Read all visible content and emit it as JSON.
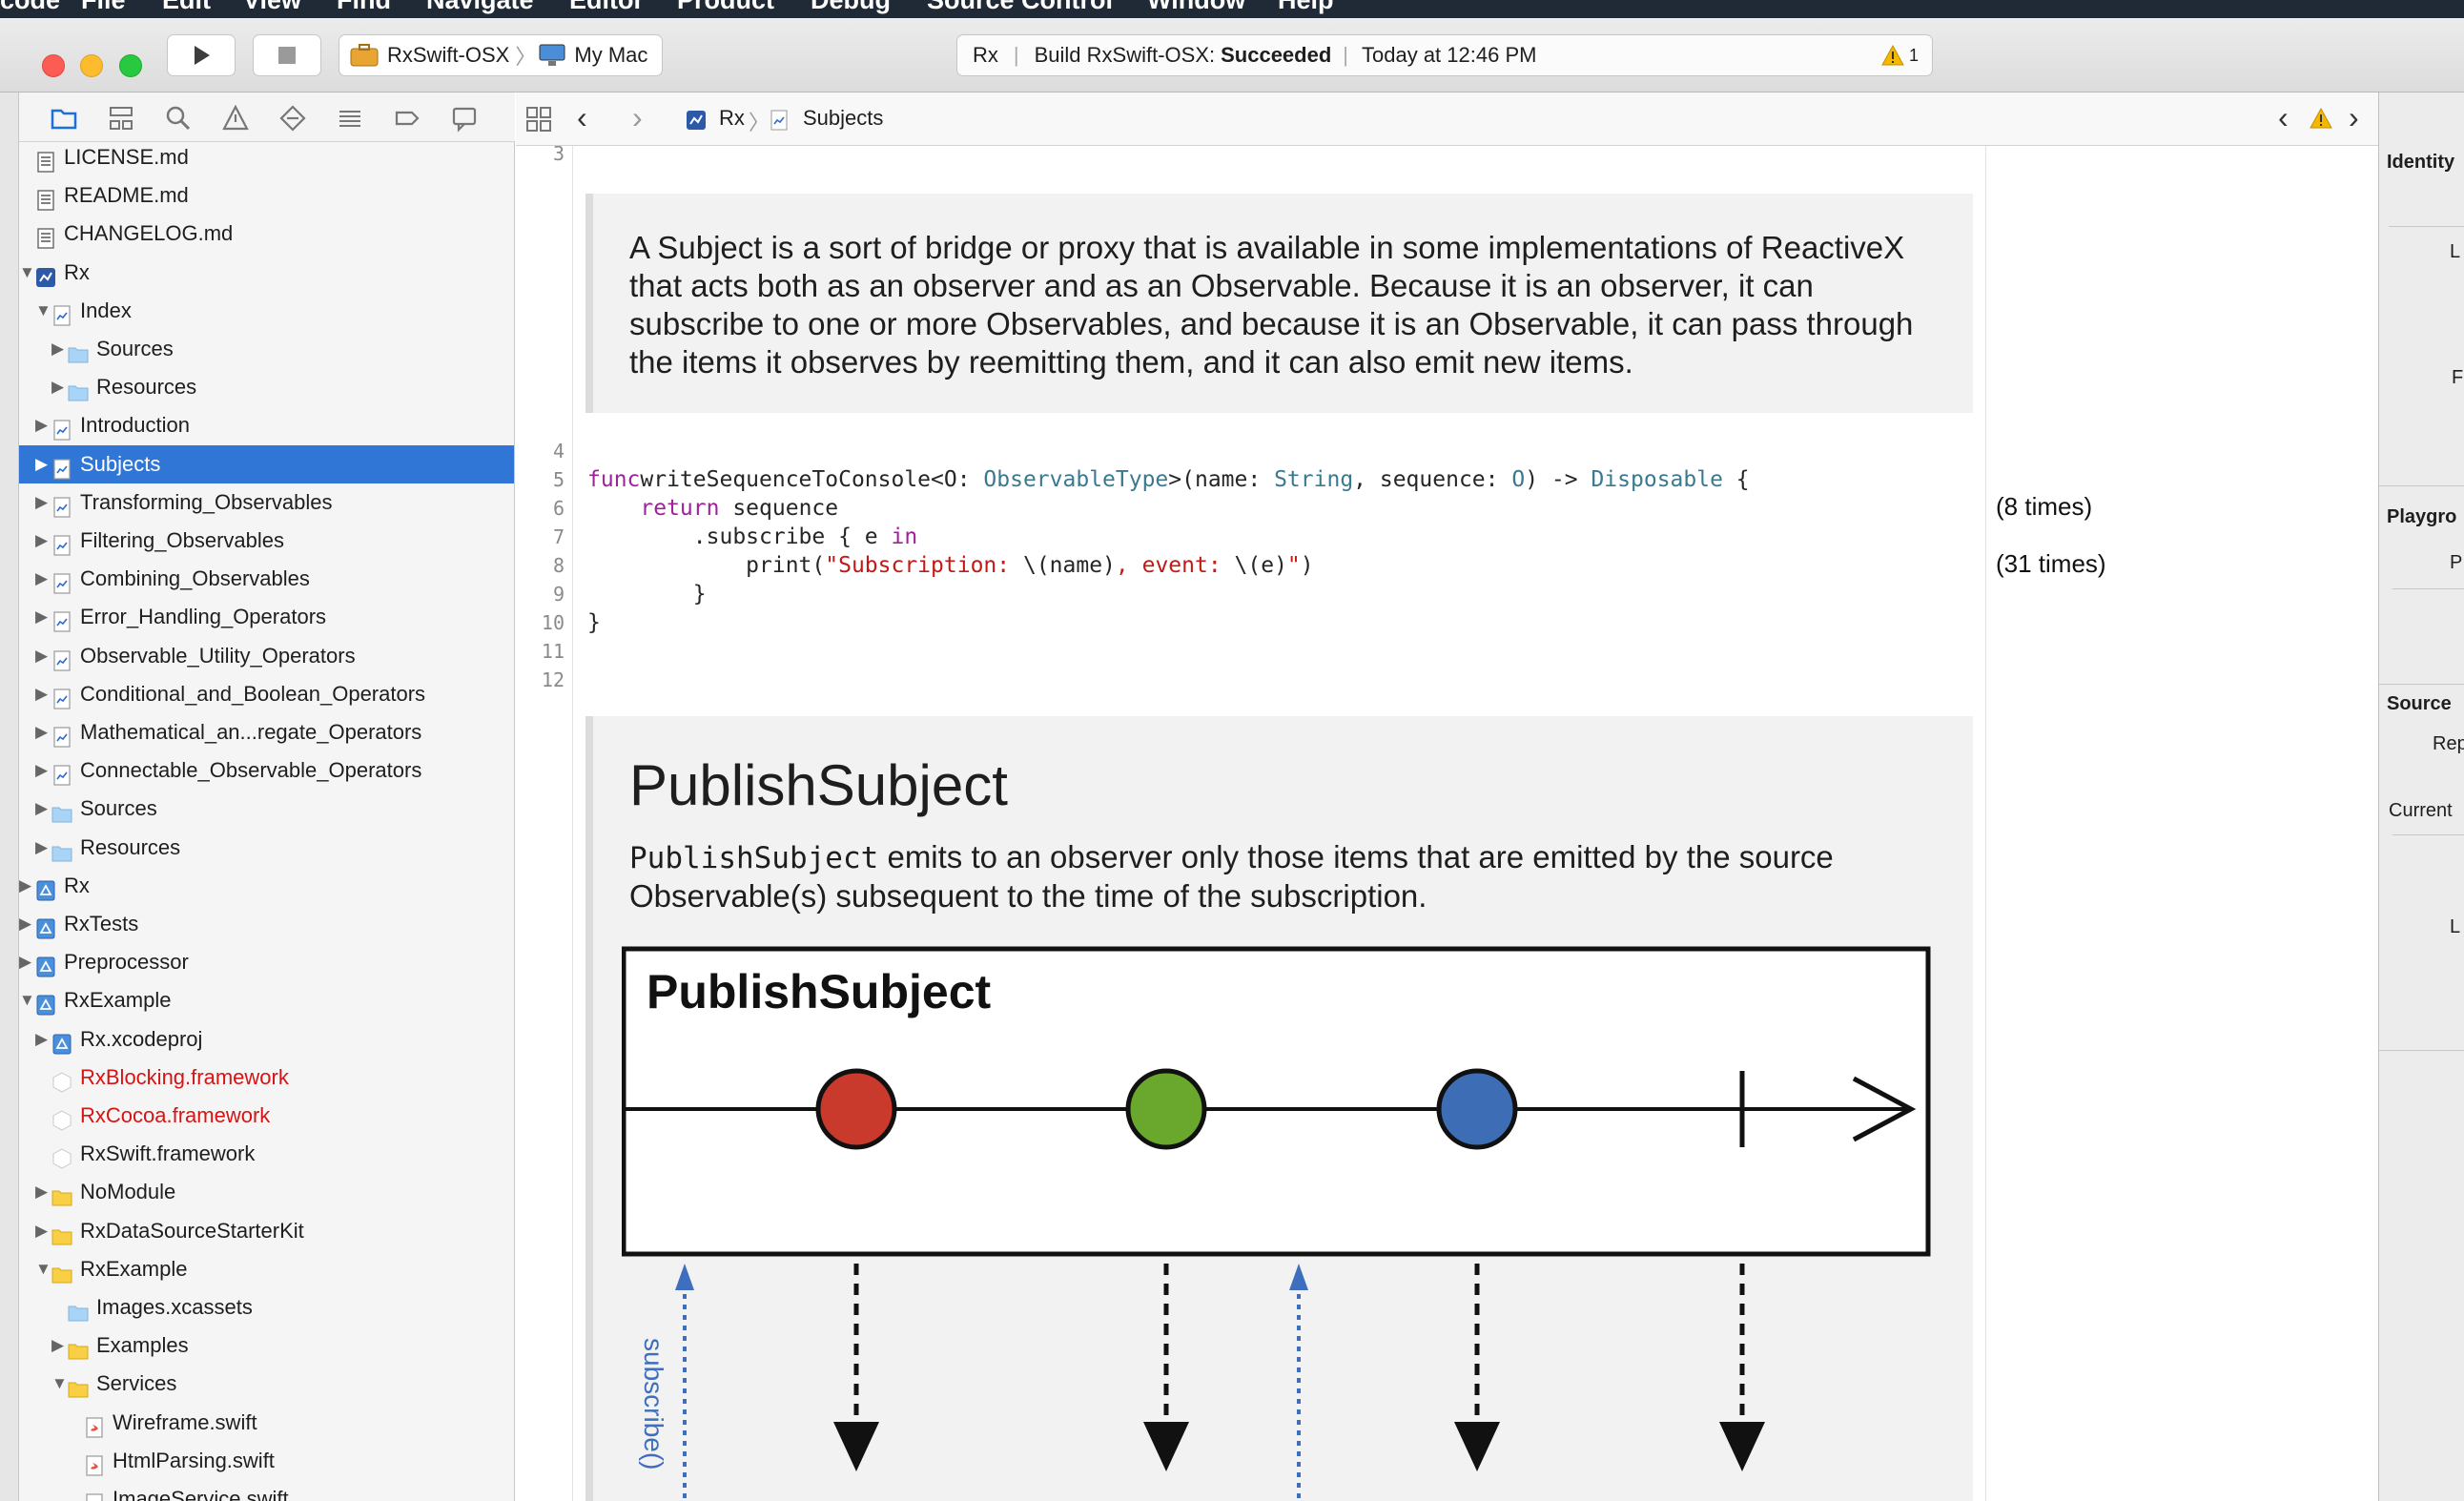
{
  "menu": [
    "Xcode",
    "File",
    "Edit",
    "View",
    "Find",
    "Navigate",
    "Editor",
    "Product",
    "Debug",
    "Source Control",
    "Window",
    "Help"
  ],
  "toolbar": {
    "scheme": "RxSwift-OSX",
    "destination": "My Mac",
    "activity_project": "Rx",
    "activity_status_prefix": "Build RxSwift-OSX:",
    "activity_status": "Succeeded",
    "activity_time": "Today at 12:46 PM",
    "warning_count": "1"
  },
  "navigator": {
    "rows": [
      {
        "label": "LICENSE.md",
        "indent": 0,
        "tri": "",
        "icon": "doc"
      },
      {
        "label": "README.md",
        "indent": 0,
        "tri": "",
        "icon": "doc"
      },
      {
        "label": "CHANGELOG.md",
        "indent": 0,
        "tri": "",
        "icon": "doc"
      },
      {
        "label": "Rx",
        "indent": 0,
        "tri": "open",
        "icon": "playground"
      },
      {
        "label": "Index",
        "indent": 1,
        "tri": "open",
        "icon": "page"
      },
      {
        "label": "Sources",
        "indent": 2,
        "tri": "closed",
        "icon": "folder-blue"
      },
      {
        "label": "Resources",
        "indent": 2,
        "tri": "closed",
        "icon": "folder-blue"
      },
      {
        "label": "Introduction",
        "indent": 1,
        "tri": "closed",
        "icon": "page"
      },
      {
        "label": "Subjects",
        "indent": 1,
        "tri": "closed",
        "icon": "page",
        "selected": true
      },
      {
        "label": "Transforming_Observables",
        "indent": 1,
        "tri": "closed",
        "icon": "page"
      },
      {
        "label": "Filtering_Observables",
        "indent": 1,
        "tri": "closed",
        "icon": "page"
      },
      {
        "label": "Combining_Observables",
        "indent": 1,
        "tri": "closed",
        "icon": "page"
      },
      {
        "label": "Error_Handling_Operators",
        "indent": 1,
        "tri": "closed",
        "icon": "page"
      },
      {
        "label": "Observable_Utility_Operators",
        "indent": 1,
        "tri": "closed",
        "icon": "page"
      },
      {
        "label": "Conditional_and_Boolean_Operators",
        "indent": 1,
        "tri": "closed",
        "icon": "page"
      },
      {
        "label": "Mathematical_an...regate_Operators",
        "indent": 1,
        "tri": "closed",
        "icon": "page"
      },
      {
        "label": "Connectable_Observable_Operators",
        "indent": 1,
        "tri": "closed",
        "icon": "page"
      },
      {
        "label": "Sources",
        "indent": 1,
        "tri": "closed",
        "icon": "folder-blue"
      },
      {
        "label": "Resources",
        "indent": 1,
        "tri": "closed",
        "icon": "folder-blue"
      },
      {
        "label": "Rx",
        "indent": 0,
        "tri": "closed",
        "icon": "project"
      },
      {
        "label": "RxTests",
        "indent": 0,
        "tri": "closed",
        "icon": "project"
      },
      {
        "label": "Preprocessor",
        "indent": 0,
        "tri": "closed",
        "icon": "project"
      },
      {
        "label": "RxExample",
        "indent": 0,
        "tri": "open",
        "icon": "project"
      },
      {
        "label": "Rx.xcodeproj",
        "indent": 1,
        "tri": "closed",
        "icon": "project"
      },
      {
        "label": "RxBlocking.framework",
        "indent": 1,
        "tri": "",
        "icon": "framework",
        "red": true
      },
      {
        "label": "RxCocoa.framework",
        "indent": 1,
        "tri": "",
        "icon": "framework",
        "red": true
      },
      {
        "label": "RxSwift.framework",
        "indent": 1,
        "tri": "",
        "icon": "framework"
      },
      {
        "label": "NoModule",
        "indent": 1,
        "tri": "closed",
        "icon": "folder"
      },
      {
        "label": "RxDataSourceStarterKit",
        "indent": 1,
        "tri": "closed",
        "icon": "folder"
      },
      {
        "label": "RxExample",
        "indent": 1,
        "tri": "open",
        "icon": "folder"
      },
      {
        "label": "Images.xcassets",
        "indent": 2,
        "tri": "",
        "icon": "folder-blue"
      },
      {
        "label": "Examples",
        "indent": 2,
        "tri": "closed",
        "icon": "folder"
      },
      {
        "label": "Services",
        "indent": 2,
        "tri": "open",
        "icon": "folder"
      },
      {
        "label": "Wireframe.swift",
        "indent": 3,
        "tri": "",
        "icon": "swift"
      },
      {
        "label": "HtmlParsing.swift",
        "indent": 3,
        "tri": "",
        "icon": "swift"
      },
      {
        "label": "ImageService.swift",
        "indent": 3,
        "tri": "",
        "icon": "swift"
      }
    ]
  },
  "jumpbar": {
    "crumb1": "Rx",
    "crumb2": "Subjects"
  },
  "editor": {
    "line_top": "3",
    "intro_text": "A Subject is a sort of bridge or proxy that is available in some implementations of ReactiveX that acts both as an observer and as an Observable. Because it is an observer, it can subscribe to one or more Observables, and because it is an Observable, it can pass through the items it observes by reemitting them, and it can also emit new items.",
    "code_lines": [
      {
        "n": "4",
        "tokens": []
      },
      {
        "n": "5",
        "tokens": [
          [
            "kw",
            "func"
          ],
          [
            "",
            "writeSequenceToConsole<O: "
          ],
          [
            "ty",
            "ObservableType"
          ],
          [
            "",
            ">(name: "
          ],
          [
            "ty",
            "String"
          ],
          [
            "",
            ", sequence: "
          ],
          [
            "ty",
            "O"
          ],
          [
            "",
            ") -> "
          ],
          [
            "ty",
            "Disposable"
          ],
          [
            "",
            " {"
          ]
        ]
      },
      {
        "n": "6",
        "tokens": [
          [
            "",
            "    "
          ],
          [
            "kw",
            "return"
          ],
          [
            "",
            " sequence"
          ]
        ]
      },
      {
        "n": "7",
        "tokens": [
          [
            "",
            "        .subscribe { e "
          ],
          [
            "kw",
            "in"
          ]
        ]
      },
      {
        "n": "8",
        "tokens": [
          [
            "",
            "            print("
          ],
          [
            "st",
            "\"Subscription: "
          ],
          [
            "",
            "\\(name)"
          ],
          [
            "st",
            ", event: "
          ],
          [
            "",
            "\\(e)"
          ],
          [
            "st",
            "\""
          ],
          [
            "",
            ")"
          ]
        ]
      },
      {
        "n": "9",
        "tokens": [
          [
            "",
            "        }"
          ]
        ]
      },
      {
        "n": "10",
        "tokens": [
          [
            "",
            "}"
          ]
        ]
      },
      {
        "n": "11",
        "tokens": []
      },
      {
        "n": "12",
        "tokens": []
      }
    ],
    "heading": "PublishSubject",
    "desc_code": "PublishSubject",
    "desc_text": " emits to an observer only those items that are emitted by the source Observable(s) subsequent to the time of the subscription.",
    "diagram_title": "PublishSubject",
    "subscribe_label": "subscribe()",
    "marble_colors": [
      "#c9392c",
      "#6aa82d",
      "#3c6db5"
    ]
  },
  "results": {
    "r1": "(8 times)",
    "r2": "(31 times)"
  },
  "inspector": {
    "identity": "Identity",
    "playground": "Playgro",
    "source": "Source",
    "rep": "Rep",
    "current": "Current"
  }
}
